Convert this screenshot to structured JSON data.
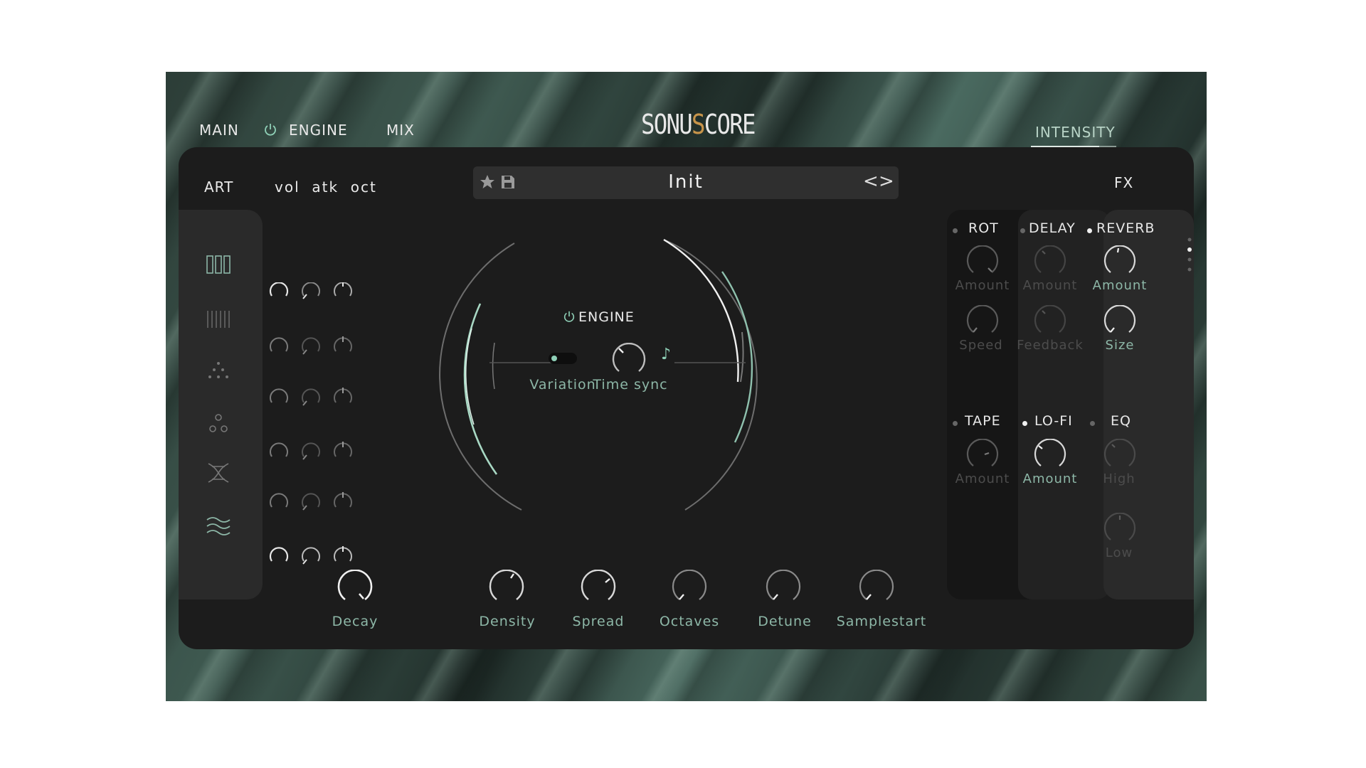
{
  "header": {
    "tabs": [
      {
        "label": "MAIN",
        "active": false
      },
      {
        "label": "ENGINE",
        "active": true
      },
      {
        "label": "MIX",
        "active": false
      }
    ],
    "logo": {
      "part1": "SONU",
      "part2": "S",
      "part3": "CORE"
    },
    "intensity_label": "INTENSITY",
    "intensity_level": 0.8
  },
  "toolbar": {
    "art_label": "ART",
    "vol_label": "vol  atk  oct",
    "preset_name": "Init",
    "prev_symbol": "<",
    "next_symbol": ">",
    "fx_label": "FX"
  },
  "articulations": [
    {
      "icon": "three-bars-icon",
      "active": true
    },
    {
      "icon": "many-lines-icon",
      "active": false
    },
    {
      "icon": "dot-triangle-icon",
      "active": false
    },
    {
      "icon": "circles-icon",
      "active": false
    },
    {
      "icon": "dna-icon",
      "active": false
    },
    {
      "icon": "wave-icon",
      "active": true
    }
  ],
  "engine": {
    "title": "ENGINE",
    "variation_label": "Variation",
    "timesync_label": "Time sync",
    "note_symbol": "♪"
  },
  "bottom_knobs": {
    "decay": "Decay",
    "density": "Density",
    "spread": "Spread",
    "octaves": "Octaves",
    "detune": "Detune",
    "samplestart": "Samplestart"
  },
  "fx": {
    "rot": {
      "name": "ROT",
      "amount": "Amount",
      "speed": "Speed"
    },
    "delay": {
      "name": "DELAY",
      "amount": "Amount",
      "feedback": "Feedback"
    },
    "reverb": {
      "name": "REVERB",
      "amount": "Amount",
      "size": "Size"
    },
    "tape": {
      "name": "TAPE",
      "amount": "Amount"
    },
    "lofi": {
      "name": "LO-FI",
      "amount": "Amount"
    },
    "eq": {
      "name": "EQ",
      "high": "High",
      "low": "Low"
    }
  },
  "colors": {
    "accent": "#8db7a7",
    "panel": "#1c1c1c",
    "logo_s": "#c7944a"
  }
}
